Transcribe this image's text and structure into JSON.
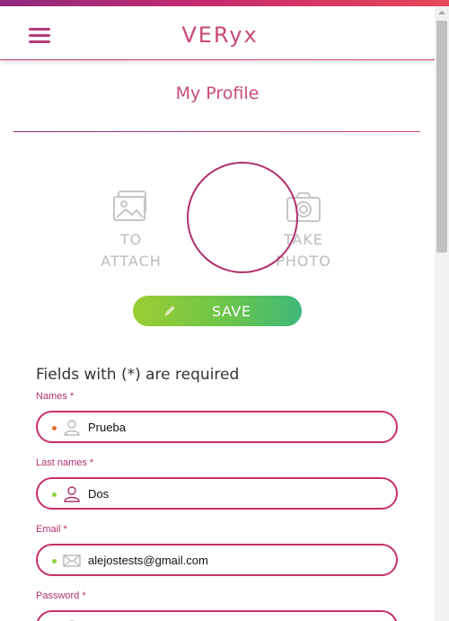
{
  "header": {
    "brand": "VERyx",
    "menu_icon": "hamburger-menu-icon"
  },
  "page": {
    "title": "My Profile"
  },
  "media": {
    "attach_label": "TO ATTACH",
    "photo_label": "TAKE PHOTO",
    "attach_icon": "image-icon",
    "photo_icon": "camera-icon"
  },
  "save": {
    "label": "SAVE",
    "icon": "pencil-icon"
  },
  "form": {
    "required_note": "Fields with (*) are required",
    "fields": [
      {
        "label": "Names *",
        "value": "Prueba",
        "icon": "user-icon",
        "dot_color": "#e07030"
      },
      {
        "label": "Last names *",
        "value": "Dos",
        "icon": "user-icon",
        "dot_color": "#8ccf3a"
      },
      {
        "label": "Email *",
        "value": "alejostests@gmail.com",
        "icon": "envelope-icon",
        "dot_color": "#8ccf3a"
      },
      {
        "label": "Password *",
        "value": "",
        "icon": "lock-icon",
        "dot_color": "#8ccf3a"
      }
    ]
  },
  "colors": {
    "accent": "#c84a78",
    "border": "#c8306a",
    "save_start": "#9acd32",
    "save_end": "#3fb97a"
  }
}
